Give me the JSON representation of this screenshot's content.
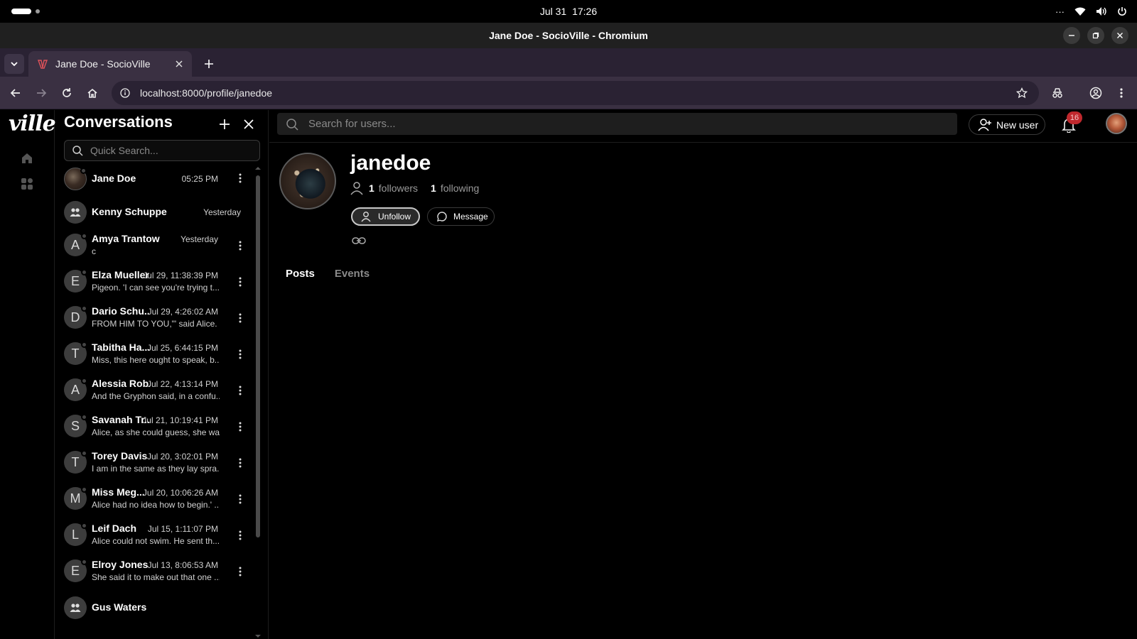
{
  "system": {
    "date": "Jul 31",
    "time": "17:26",
    "tray_more": "···"
  },
  "window": {
    "title": "Jane Doe - SocioVille - Chromium"
  },
  "browser": {
    "tab_title": "Jane Doe - SocioVille",
    "url": "localhost:8000/profile/janedoe"
  },
  "app": {
    "logo": "ville"
  },
  "conversations": {
    "title": "Conversations",
    "search_placeholder": "Quick Search...",
    "items": [
      {
        "name": "Jane Doe",
        "time": "05:25 PM",
        "preview": "",
        "initial": "",
        "avatar": "photo",
        "menu": true
      },
      {
        "name": "Kenny Schuppe",
        "time": "Yesterday",
        "preview": "",
        "initial": "",
        "avatar": "group",
        "menu": false
      },
      {
        "name": "Amya Trantow",
        "time": "Yesterday",
        "preview": "c",
        "initial": "A",
        "avatar": "letter",
        "menu": true
      },
      {
        "name": "Elza Mueller",
        "time": "Jul 29, 11:38:39 PM",
        "preview": "Pigeon. 'I can see you're trying t...",
        "initial": "E",
        "avatar": "letter",
        "menu": true
      },
      {
        "name": "Dario Schu...",
        "time": "Jul 29, 4:26:02 AM",
        "preview": "FROM HIM TO YOU,\"' said Alice. ...",
        "initial": "D",
        "avatar": "letter",
        "menu": true
      },
      {
        "name": "Tabitha Ha...",
        "time": "Jul 25, 6:44:15 PM",
        "preview": "Miss, this here ought to speak, b...",
        "initial": "T",
        "avatar": "letter",
        "menu": true
      },
      {
        "name": "Alessia Rob...",
        "time": "Jul 22, 4:13:14 PM",
        "preview": "And the Gryphon said, in a confu...",
        "initial": "A",
        "avatar": "letter",
        "menu": true
      },
      {
        "name": "Savanah Tr...",
        "time": "Jul 21, 10:19:41 PM",
        "preview": "Alice, as she could guess, she wa...",
        "initial": "S",
        "avatar": "letter",
        "menu": true
      },
      {
        "name": "Torey Davis",
        "time": "Jul 20, 3:02:01 PM",
        "preview": "I am in the same as they lay spra...",
        "initial": "T",
        "avatar": "letter",
        "menu": true
      },
      {
        "name": "Miss Meg...",
        "time": "Jul 20, 10:06:26 AM",
        "preview": "Alice had no idea how to begin.' ...",
        "initial": "M",
        "avatar": "letter",
        "menu": true
      },
      {
        "name": "Leif Dach",
        "time": "Jul 15, 1:11:07 PM",
        "preview": "Alice could not swim. He sent th...",
        "initial": "L",
        "avatar": "letter",
        "menu": true
      },
      {
        "name": "Elroy Jones",
        "time": "Jul 13, 8:06:53 AM",
        "preview": "She said it to make out that one ...",
        "initial": "E",
        "avatar": "letter",
        "menu": true
      },
      {
        "name": "Gus Waters",
        "time": "",
        "preview": "",
        "initial": "",
        "avatar": "group",
        "menu": false
      }
    ]
  },
  "topnav": {
    "search_placeholder": "Search for users...",
    "new_user_label": "New user",
    "notification_count": "16"
  },
  "profile": {
    "username": "janedoe",
    "followers_count": "1",
    "followers_label": "followers",
    "following_count": "1",
    "following_label": "following",
    "unfollow_label": "Unfollow",
    "message_label": "Message",
    "tabs": [
      "Posts",
      "Events"
    ],
    "active_tab": "Posts"
  },
  "colors": {
    "accent": "#c0282d",
    "tabstrip": "#2a2233",
    "toolbar": "#3a3042"
  }
}
